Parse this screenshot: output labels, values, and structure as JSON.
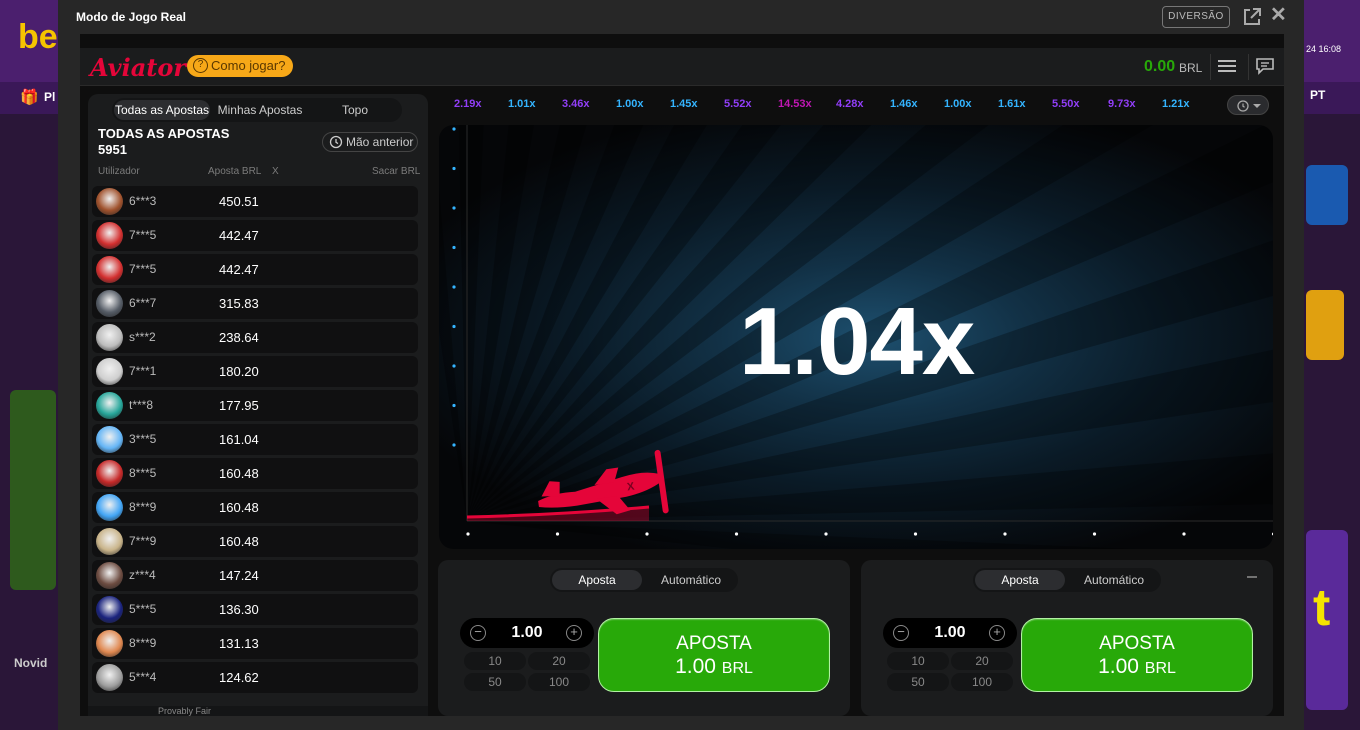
{
  "background_site": {
    "logo": "be",
    "date_fragment": "24 16:08",
    "nav_text": "Pl",
    "lang": "PT",
    "section_label": "Novid",
    "right_glyph": "t"
  },
  "modal": {
    "title": "Modo de Jogo Real",
    "demo_button": "DIVERSÃO"
  },
  "header": {
    "logo": "Aviator",
    "how_to_play": "Como jogar?",
    "balance": "0.00",
    "currency": "BRL"
  },
  "bets_panel": {
    "tabs": [
      "Todas as Apostas",
      "Minhas Apostas",
      "Topo"
    ],
    "active_tab": "Todas as Apostas",
    "title": "TODAS AS APOSTAS",
    "count": "5951",
    "prev_hand_button": "Mão anterior",
    "columns": {
      "user": "Utilizador",
      "bet": "Aposta BRL",
      "x": "X",
      "cashout": "Sacar BRL"
    },
    "rows": [
      {
        "user": "6***3",
        "bet": "450.51",
        "avatar_color": "#a0522d"
      },
      {
        "user": "7***5",
        "bet": "442.47",
        "avatar_color": "#d32f2f"
      },
      {
        "user": "7***5",
        "bet": "442.47",
        "avatar_color": "#d32f2f"
      },
      {
        "user": "6***7",
        "bet": "315.83",
        "avatar_color": "#555c66"
      },
      {
        "user": "s***2",
        "bet": "238.64",
        "avatar_color": "#bdbdbd"
      },
      {
        "user": "7***1",
        "bet": "180.20",
        "avatar_color": "#cfcfcf"
      },
      {
        "user": "t***8",
        "bet": "177.95",
        "avatar_color": "#26a69a"
      },
      {
        "user": "3***5",
        "bet": "161.04",
        "avatar_color": "#64b5f6"
      },
      {
        "user": "8***5",
        "bet": "160.48",
        "avatar_color": "#c62828"
      },
      {
        "user": "8***9",
        "bet": "160.48",
        "avatar_color": "#42a5f5"
      },
      {
        "user": "7***9",
        "bet": "160.48",
        "avatar_color": "#c9b48a"
      },
      {
        "user": "z***4",
        "bet": "147.24",
        "avatar_color": "#6d4c41"
      },
      {
        "user": "5***5",
        "bet": "136.30",
        "avatar_color": "#1a237e"
      },
      {
        "user": "8***9",
        "bet": "131.13",
        "avatar_color": "#e08850"
      },
      {
        "user": "5***4",
        "bet": "124.62",
        "avatar_color": "#9e9e9e"
      }
    ],
    "footer": "Provably Fair"
  },
  "history": [
    {
      "value": "2.19x",
      "color": "#913ef8"
    },
    {
      "value": "1.01x",
      "color": "#34b4ff"
    },
    {
      "value": "3.46x",
      "color": "#913ef8"
    },
    {
      "value": "1.00x",
      "color": "#34b4ff"
    },
    {
      "value": "1.45x",
      "color": "#34b4ff"
    },
    {
      "value": "5.52x",
      "color": "#913ef8"
    },
    {
      "value": "14.53x",
      "color": "#c017b4"
    },
    {
      "value": "4.28x",
      "color": "#913ef8"
    },
    {
      "value": "1.46x",
      "color": "#34b4ff"
    },
    {
      "value": "1.00x",
      "color": "#34b4ff"
    },
    {
      "value": "1.61x",
      "color": "#34b4ff"
    },
    {
      "value": "5.50x",
      "color": "#913ef8"
    },
    {
      "value": "9.73x",
      "color": "#913ef8"
    },
    {
      "value": "1.21x",
      "color": "#34b4ff"
    }
  ],
  "game": {
    "multiplier": "1.04x",
    "plane_color": "#e50539"
  },
  "bet_panels": [
    {
      "tabs": [
        "Aposta",
        "Automático"
      ],
      "active_tab": "Aposta",
      "amount": "1.00",
      "quick_amounts": [
        "10",
        "20",
        "50",
        "100"
      ],
      "button_line1": "APOSTA",
      "button_amount": "1.00",
      "button_currency": "BRL"
    },
    {
      "tabs": [
        "Aposta",
        "Automático"
      ],
      "active_tab": "Aposta",
      "amount": "1.00",
      "quick_amounts": [
        "10",
        "20",
        "50",
        "100"
      ],
      "button_line1": "APOSTA",
      "button_amount": "1.00",
      "button_currency": "BRL"
    }
  ],
  "colors": {
    "accent_red": "#e50539",
    "balance_green": "#28a909",
    "how_to_play_yellow": "#f7a818"
  }
}
